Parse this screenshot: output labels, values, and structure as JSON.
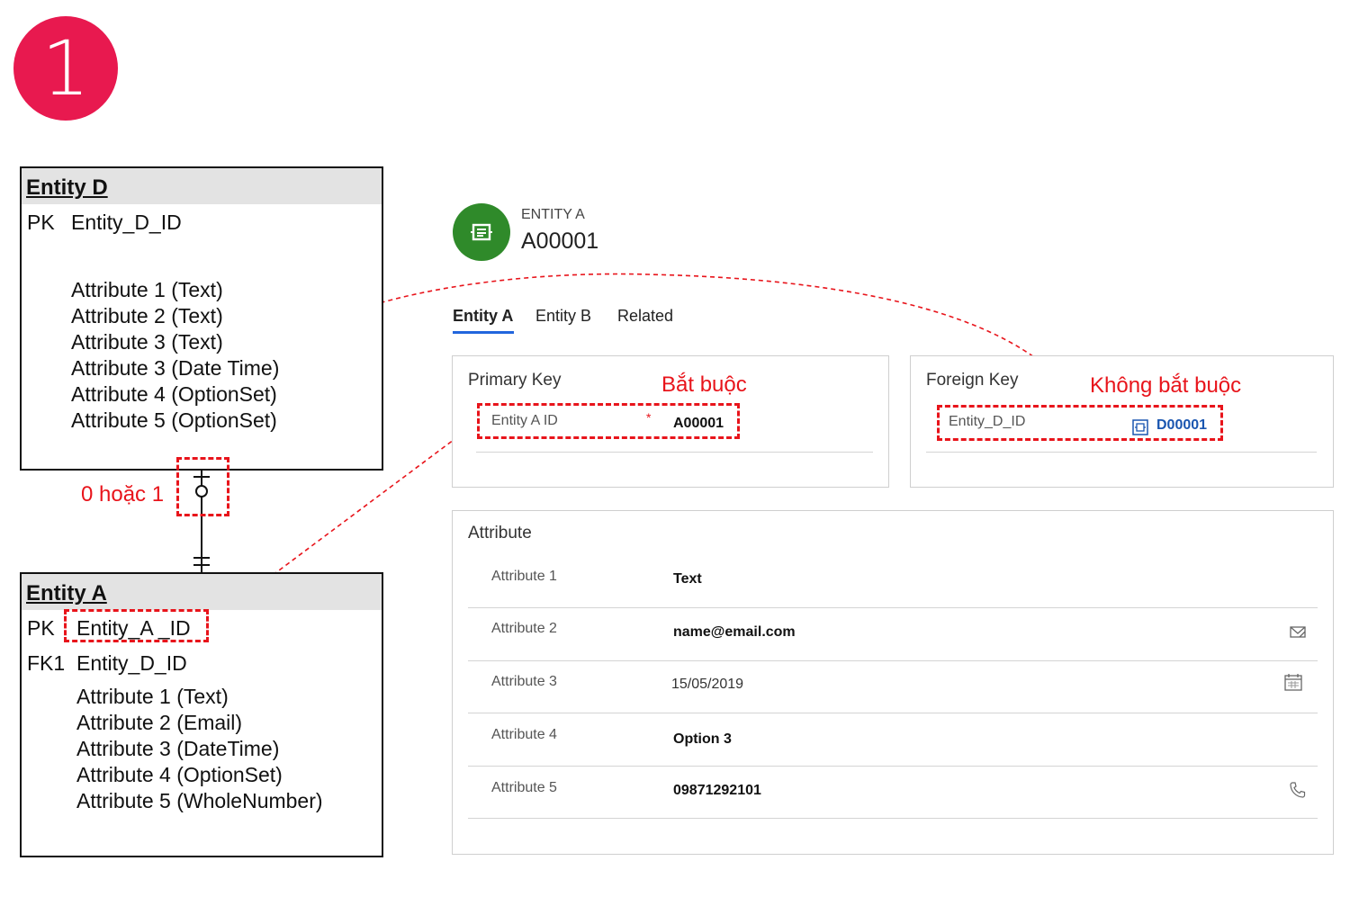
{
  "step_number": "1",
  "erd": {
    "entity_d": {
      "title": "Entity D",
      "pk_label": "PK",
      "pk_field": "Entity_D_ID",
      "attributes": [
        "Attribute 1 (Text)",
        "Attribute 2 (Text)",
        "Attribute 3 (Text)",
        "Attribute 3 (Date Time)",
        "Attribute 4 (OptionSet)",
        "Attribute 5 (OptionSet)"
      ]
    },
    "entity_a": {
      "title": "Entity A",
      "pk_label": "PK",
      "pk_field": "Entity_A _ID",
      "fk_label": "FK1",
      "fk_field": "Entity_D_ID",
      "attributes": [
        "Attribute 1 (Text)",
        "Attribute 2 (Email)",
        "Attribute 3 (DateTime)",
        "Attribute 4 (OptionSet)",
        "Attribute 5 (WholeNumber)"
      ]
    },
    "cardinality_note": "0 hoặc 1"
  },
  "form": {
    "entity_type": "ENTITY A",
    "record_name": "A00001",
    "avatar_icon": "entity-icon",
    "tabs": [
      {
        "label": "Entity A",
        "active": true
      },
      {
        "label": "Entity B",
        "active": false
      },
      {
        "label": "Related",
        "active": false
      }
    ],
    "primary_key": {
      "title": "Primary Key",
      "note": "Bắt buộc",
      "label": "Entity A ID",
      "required_mark": "*",
      "value": "A00001"
    },
    "foreign_key": {
      "title": "Foreign Key",
      "note": "Không bắt buộc",
      "label": "Entity_D_ID",
      "value": "D00001",
      "lookup_icon": "entity-lookup-icon"
    },
    "attribute_section": {
      "title": "Attribute",
      "rows": [
        {
          "label": "Attribute 1",
          "value": "Text",
          "icon": ""
        },
        {
          "label": "Attribute 2",
          "value": "name@email.com",
          "icon": "email-icon"
        },
        {
          "label": "Attribute 3",
          "value": "15/05/2019",
          "icon": "calendar-icon"
        },
        {
          "label": "Attribute 4",
          "value": "Option 3",
          "icon": ""
        },
        {
          "label": "Attribute 5",
          "value": "09871292101",
          "icon": "phone-icon"
        }
      ]
    }
  },
  "colors": {
    "badge": "#e8194f",
    "annotation_red": "#e8141b",
    "avatar_green": "#2f8a2a",
    "tab_underline": "#2266dd",
    "lookup_blue": "#1a56b0"
  }
}
